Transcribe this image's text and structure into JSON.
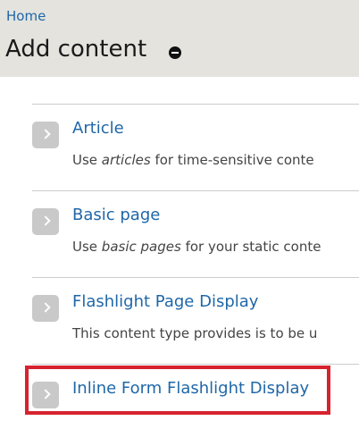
{
  "breadcrumb": {
    "home_label": "Home"
  },
  "page": {
    "title": "Add content"
  },
  "items": [
    {
      "title": "Article",
      "desc_before": "Use ",
      "desc_em": "articles",
      "desc_after": " for time-sensitive conte",
      "icon": "chevron-right-icon"
    },
    {
      "title": "Basic page",
      "desc_before": "Use ",
      "desc_em": "basic pages",
      "desc_after": " for your static conte",
      "icon": "chevron-right-icon"
    },
    {
      "title": "Flashlight Page Display",
      "desc_before": "This content type provides is to be u",
      "desc_em": "",
      "desc_after": "",
      "icon": "chevron-right-icon"
    },
    {
      "title": "Inline Form Flashlight Display",
      "icon": "chevron-right-icon",
      "highlighted": true
    }
  ],
  "colors": {
    "header_bg": "#e4e3de",
    "link": "#1f67a8",
    "highlight": "#d6232f"
  }
}
